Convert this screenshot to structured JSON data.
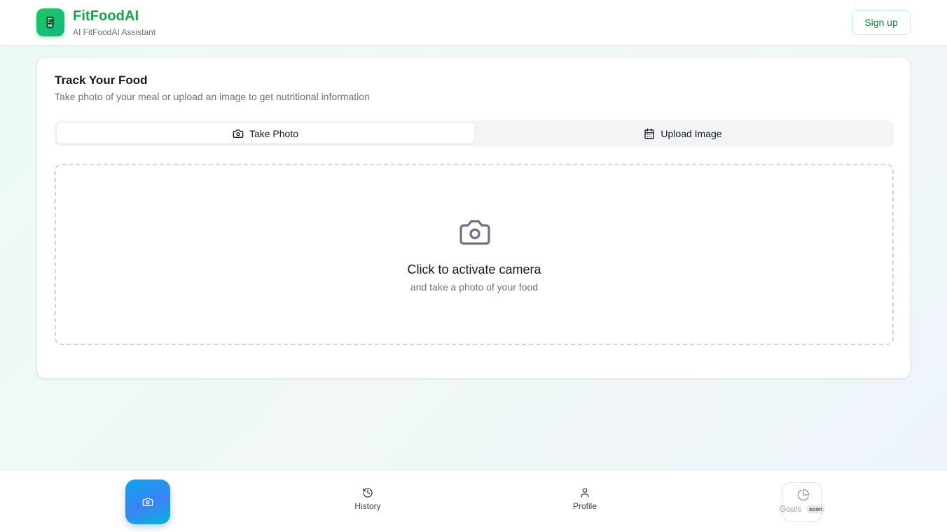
{
  "header": {
    "brand_name": "FitFoodAI",
    "brand_sub": "AI FitFoodAI Assistant",
    "signup_label": "Sign up",
    "logo_icon": "food-leaf-icon"
  },
  "card": {
    "title": "Track Your Food",
    "description": "Take photo of your meal or upload an image to get nutritional information",
    "tabs": [
      {
        "label": "Take Photo",
        "icon": "camera-icon",
        "active": true
      },
      {
        "label": "Upload Image",
        "icon": "calendar-icon",
        "active": false
      }
    ],
    "dropzone": {
      "icon": "camera-icon",
      "title": "Click to activate camera",
      "subtitle": "and take a photo of your food"
    }
  },
  "bottom_nav": {
    "camera_icon": "camera-icon",
    "items": [
      {
        "label": "History",
        "icon": "history-icon"
      },
      {
        "label": "Profile",
        "icon": "user-icon"
      },
      {
        "label": "Goals",
        "icon": "pie-chart-icon",
        "badge": "soon",
        "disabled": true
      }
    ]
  },
  "colors": {
    "brand_green": "#16a34a",
    "accent_blue": "#3b82f6"
  }
}
